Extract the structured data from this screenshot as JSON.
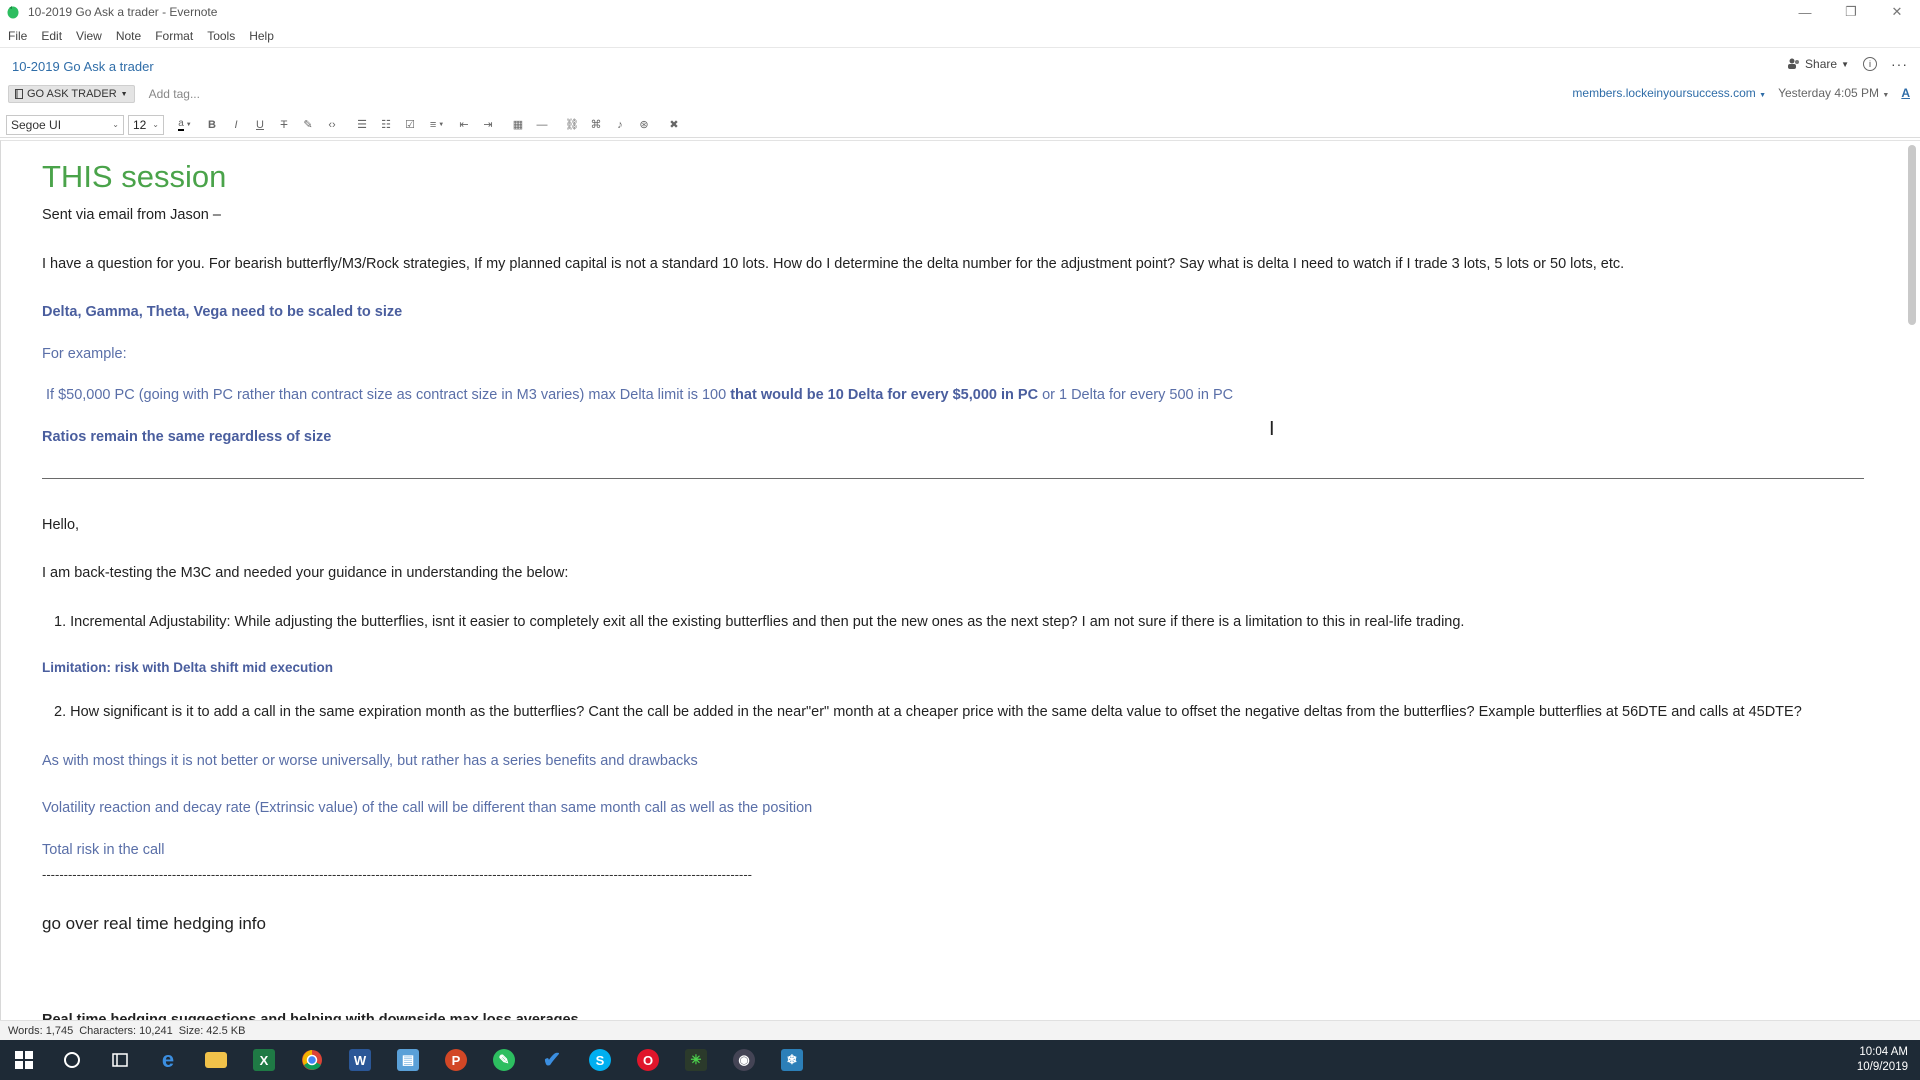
{
  "window": {
    "title": "10-2019 Go Ask a trader - Evernote",
    "minimize": "—",
    "restore": "❐",
    "close": "✕"
  },
  "menu": [
    "File",
    "Edit",
    "View",
    "Note",
    "Format",
    "Tools",
    "Help"
  ],
  "note": {
    "title": "10-2019 Go Ask a trader",
    "share_label": "Share",
    "notebook": "GO ASK TRADER",
    "add_tag": "Add tag...",
    "source_url": "members.lockeinyoursuccess.com",
    "updated": "Yesterday 4:05 PM"
  },
  "toolbar": {
    "font": "Segoe UI",
    "size": "12"
  },
  "body": {
    "heading": "THIS session",
    "line1": "Sent via email from Jason –",
    "line2": "I have a question for you. For bearish butterfly/M3/Rock strategies, If my planned capital is not a standard 10 lots. How do I determine the delta number for the adjustment point? Say what is delta I need to watch if I trade 3 lots, 5 lots or 50 lots, etc.",
    "line3": "Delta, Gamma, Theta, Vega need to be scaled to size",
    "line4": "For example:",
    "line5a": "If $50,000 PC (going with PC rather than contract size as contract size in M3 varies) max Delta limit is 100 ",
    "line5b": "that would be 10 Delta for every $5,000 in PC",
    "line5c": " or 1 Delta for every  500 in PC",
    "line6": "Ratios remain the same regardless of size",
    "hello": "Hello,",
    "intro": "I am back-testing the M3C and needed your guidance in understanding the below:",
    "q1": "1.  Incremental Adjustability: While adjusting the butterflies, isnt it easier to completely exit all the existing butterflies and then put the new ones as the next step? I am not sure if there is a limitation to this in real-life trading.",
    "a1": "Limitation: risk with Delta shift mid execution",
    "q2": "2.  How significant is it to add a call in the same expiration month as the butterflies? Cant the call be added in the near\"er\" month at a cheaper price with the same delta value to offset the negative deltas from the butterflies? Example butterflies at 56DTE and calls at 45DTE?",
    "a2": "As with most things it is not better or worse universally, but rather has a series benefits and drawbacks",
    "a3": "Volatility reaction and decay rate  (Extrinsic value) of the call will be different than same month call as well as the position",
    "a4": "Total risk in the call",
    "dashes": "--------------------------------------------------------------------------------------------------------------------------------------------------------------------",
    "realtime": "go over real time hedging info",
    "cutoff": "Real time hedging suggestions and helping with downside max loss averages"
  },
  "status": {
    "words": "Words: 1,745",
    "chars": "Characters: 10,241",
    "size": "Size: 42.5 KB"
  },
  "taskbar": {
    "time": "10:04 AM",
    "date": "10/9/2019"
  },
  "colors": {
    "heading": "#4aa34a",
    "link": "#2f6da8",
    "answer_blue": "#5a6fa8",
    "taskbar": "#1e2a36"
  }
}
